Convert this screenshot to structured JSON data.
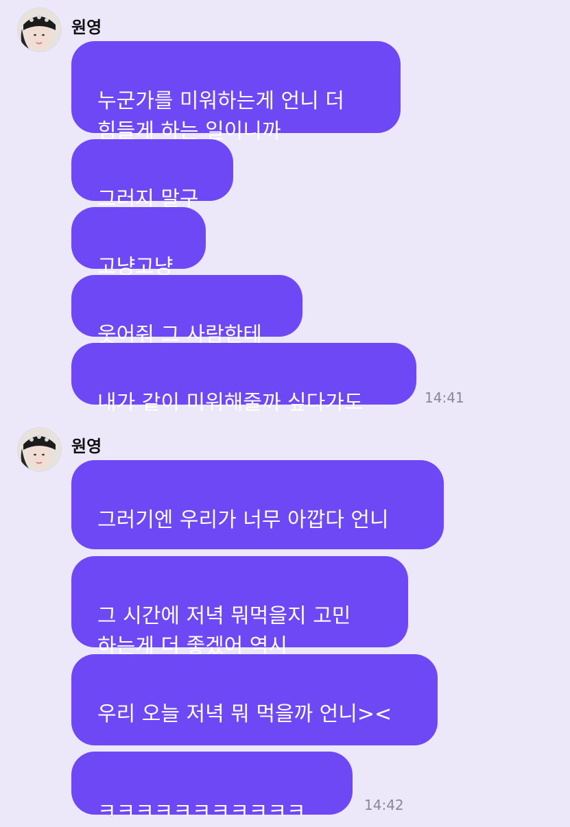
{
  "conversation": [
    {
      "sender": "원영",
      "time": "14:41",
      "messages": [
        "누군가를 미워하는게 언니 더\n힘들게 하는 일이니까",
        "그러지 말구",
        "고냥고냥",
        "웃어줘 그 사람한테",
        "내가 같이 미워해줄까 싶다가도"
      ]
    },
    {
      "sender": "원영",
      "time": "14:42",
      "messages": [
        "그러기엔 우리가 너무 아깝다 언니",
        "그 시간에 저녁 뭐먹을지 고민\n하는게 더 좋겠어 역시",
        "우리 오늘 저녁 뭐 먹을까 언니><",
        "ㅋㅋㅋㅋㅋㅋㅋㅋㅋㅋㅋ"
      ],
      "emojis": [
        "hand-over-mouth-emoji",
        "white-heart-emoji"
      ]
    }
  ],
  "colors": {
    "background": "#ece7f9",
    "bubble": "#6f48f6",
    "bubble_text": "#ffffff",
    "time_text": "#8a8795"
  }
}
